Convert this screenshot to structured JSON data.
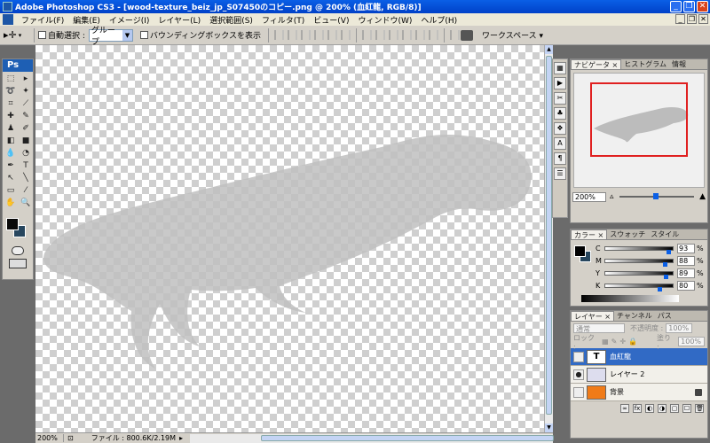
{
  "window": {
    "title": "Adobe Photoshop CS3 - [wood-texture_beiz_jp_S07450のコピー.png @ 200% (血紅龍, RGB/8)]",
    "buttons": [
      "_",
      "❐",
      "✕"
    ]
  },
  "menubar": {
    "items": [
      "ファイル(F)",
      "編集(E)",
      "イメージ(I)",
      "レイヤー(L)",
      "選択範囲(S)",
      "フィルタ(T)",
      "ビュー(V)",
      "ウィンドウ(W)",
      "ヘルプ(H)"
    ]
  },
  "options": {
    "auto_select_label": "自動選択 :",
    "auto_select_value": "グループ",
    "bounding_box_label": "バウンディングボックスを表示",
    "workspace_label": "ワークスペース ▾"
  },
  "toolbox": {
    "header": "Ps"
  },
  "status": {
    "zoom": "200%",
    "file_info": "ファイル : 800.6K/2.19M"
  },
  "navigator": {
    "tabs": [
      "ナビゲータ ×",
      "ヒストグラム",
      "情報"
    ],
    "zoom_value": "200%"
  },
  "color_panel": {
    "tabs": [
      "カラー ×",
      "スウォッチ",
      "スタイル"
    ],
    "channels": [
      {
        "label": "C",
        "value": "93",
        "pos": 0.93
      },
      {
        "label": "M",
        "value": "88",
        "pos": 0.88
      },
      {
        "label": "Y",
        "value": "89",
        "pos": 0.89
      },
      {
        "label": "K",
        "value": "80",
        "pos": 0.8
      }
    ],
    "unit": "%"
  },
  "layers_panel": {
    "tabs": [
      "レイヤー ×",
      "チャンネル",
      "パス"
    ],
    "blend_mode": "通常",
    "opacity_label": "不透明度 :",
    "opacity_value": "100%",
    "lock_label": "ロック :",
    "fill_label": "塗り :",
    "fill_value": "100%",
    "layers": [
      {
        "name": "血紅龍",
        "thumb": "T",
        "visible": false,
        "selected": true,
        "locked": false
      },
      {
        "name": "レイヤー 2",
        "thumb": "",
        "visible": true,
        "selected": false,
        "locked": false
      },
      {
        "name": "背景",
        "thumb": "",
        "visible": false,
        "selected": false,
        "locked": true
      }
    ],
    "footer_icons": [
      "fx",
      "◐",
      "◑",
      "▢",
      "☐",
      "🗑"
    ]
  },
  "colors": {
    "title_bar": "#0a5fe6",
    "foreground": "#0a0a0a",
    "background": "#27465e",
    "selection": "#316ac5",
    "nav_frame": "#e02020",
    "bg_layer": "#f07b18"
  }
}
